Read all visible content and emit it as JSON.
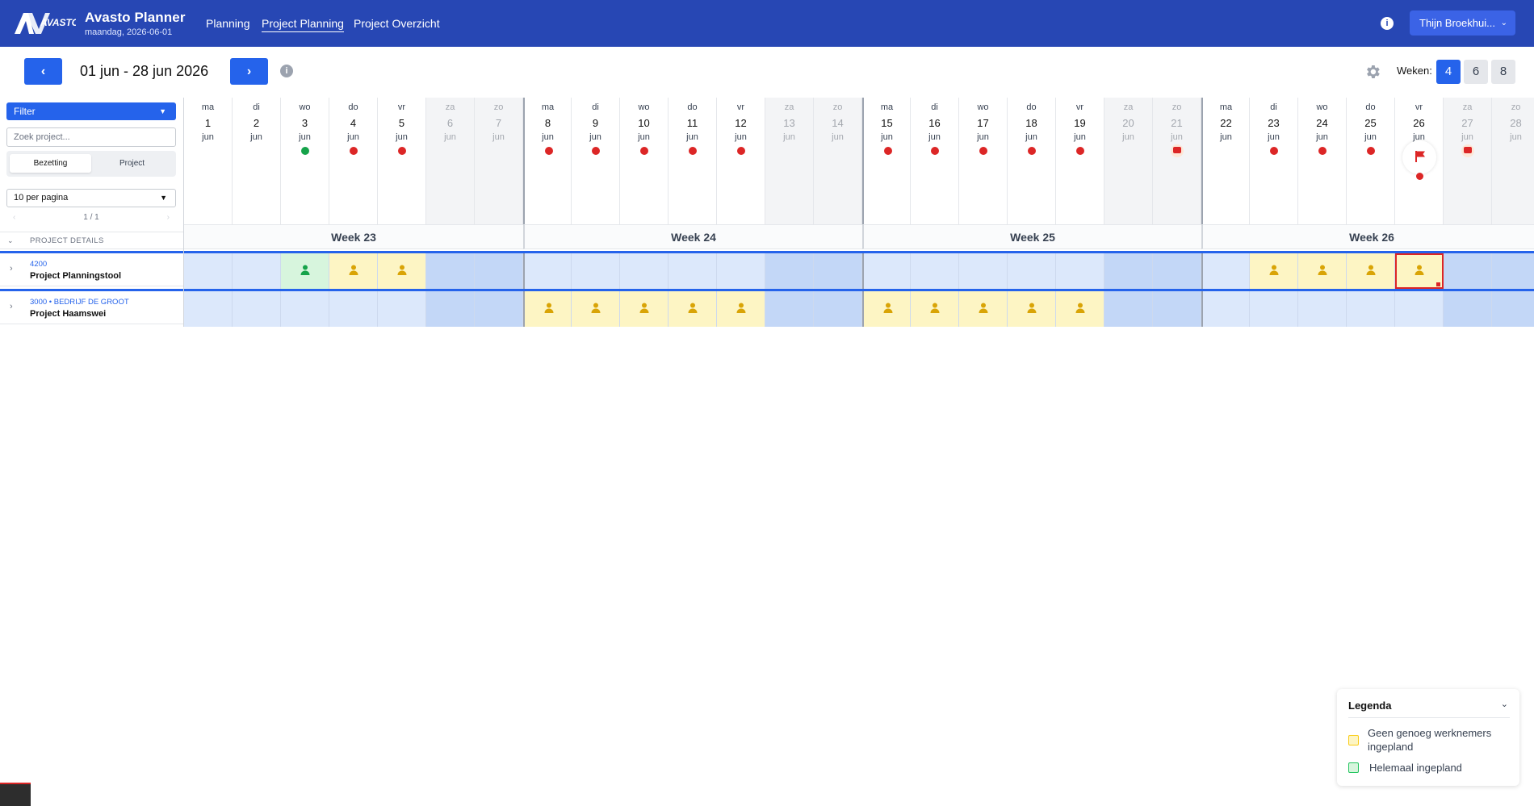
{
  "app": {
    "title": "Avasto Planner",
    "date": "maandag, 2026-06-01",
    "logo_text": "AVASTO"
  },
  "nav": {
    "items": [
      "Planning",
      "Project Planning",
      "Project Overzicht"
    ],
    "active": "Project Planning"
  },
  "user": {
    "name": "Thijn Broekhui..."
  },
  "toolbar": {
    "prev": "‹",
    "next": "›",
    "range": "01 jun - 28 jun 2026",
    "weeks_label": "Weken:",
    "week_options": [
      "4",
      "6",
      "8"
    ],
    "week_selected": "4"
  },
  "sidebar": {
    "filter_label": "Filter",
    "search_placeholder": "Zoek project...",
    "segments": [
      "Bezetting",
      "Project"
    ],
    "segment_selected": "Bezetting",
    "per_page": "10 per pagina",
    "pager": "1 / 1",
    "pager_prev": "‹",
    "pager_next": "›",
    "details_header": "PROJECT DETAILS"
  },
  "days": [
    {
      "dn": "ma",
      "d": "1",
      "m": "jun",
      "mark": ""
    },
    {
      "dn": "di",
      "d": "2",
      "m": "jun",
      "mark": ""
    },
    {
      "dn": "wo",
      "d": "3",
      "m": "jun",
      "mark": "green"
    },
    {
      "dn": "do",
      "d": "4",
      "m": "jun",
      "mark": "red"
    },
    {
      "dn": "vr",
      "d": "5",
      "m": "jun",
      "mark": "red"
    },
    {
      "dn": "za",
      "d": "6",
      "m": "jun",
      "mark": ""
    },
    {
      "dn": "zo",
      "d": "7",
      "m": "jun",
      "mark": ""
    },
    {
      "dn": "ma",
      "d": "8",
      "m": "jun",
      "mark": "red"
    },
    {
      "dn": "di",
      "d": "9",
      "m": "jun",
      "mark": "red"
    },
    {
      "dn": "wo",
      "d": "10",
      "m": "jun",
      "mark": "red"
    },
    {
      "dn": "do",
      "d": "11",
      "m": "jun",
      "mark": "red"
    },
    {
      "dn": "vr",
      "d": "12",
      "m": "jun",
      "mark": "red"
    },
    {
      "dn": "za",
      "d": "13",
      "m": "jun",
      "mark": ""
    },
    {
      "dn": "zo",
      "d": "14",
      "m": "jun",
      "mark": ""
    },
    {
      "dn": "ma",
      "d": "15",
      "m": "jun",
      "mark": "red"
    },
    {
      "dn": "di",
      "d": "16",
      "m": "jun",
      "mark": "red"
    },
    {
      "dn": "wo",
      "d": "17",
      "m": "jun",
      "mark": "red"
    },
    {
      "dn": "do",
      "d": "18",
      "m": "jun",
      "mark": "red"
    },
    {
      "dn": "vr",
      "d": "19",
      "m": "jun",
      "mark": "red"
    },
    {
      "dn": "za",
      "d": "20",
      "m": "jun",
      "mark": ""
    },
    {
      "dn": "zo",
      "d": "21",
      "m": "jun",
      "mark": "bag"
    },
    {
      "dn": "ma",
      "d": "22",
      "m": "jun",
      "mark": ""
    },
    {
      "dn": "di",
      "d": "23",
      "m": "jun",
      "mark": "red"
    },
    {
      "dn": "wo",
      "d": "24",
      "m": "jun",
      "mark": "red"
    },
    {
      "dn": "do",
      "d": "25",
      "m": "jun",
      "mark": "red"
    },
    {
      "dn": "vr",
      "d": "26",
      "m": "jun",
      "mark": "flag"
    },
    {
      "dn": "za",
      "d": "27",
      "m": "jun",
      "mark": "bag"
    },
    {
      "dn": "zo",
      "d": "28",
      "m": "jun",
      "mark": ""
    }
  ],
  "weeks": [
    "Week 23",
    "Week 24",
    "Week 25",
    "Week 26"
  ],
  "projects": [
    {
      "code": "4200",
      "name": "Project Planningstool",
      "cells": [
        "",
        "",
        "green",
        "yellow",
        "yellow",
        "",
        "",
        "",
        "",
        "",
        "",
        "",
        "",
        "",
        "",
        "",
        "",
        "",
        "",
        "",
        "",
        "",
        "yellow",
        "yellow",
        "yellow",
        "yellow",
        "",
        ""
      ],
      "selected_day": 25
    },
    {
      "code": "3000 • BEDRIJF DE GROOT",
      "name": "Project Haamswei",
      "cells": [
        "",
        "",
        "",
        "",
        "",
        "",
        "",
        "yellow",
        "yellow",
        "yellow",
        "yellow",
        "yellow",
        "",
        "",
        "yellow",
        "yellow",
        "yellow",
        "yellow",
        "yellow",
        "",
        "",
        "",
        "",
        "",
        "",
        "",
        "",
        ""
      ],
      "selected_day": -1
    }
  ],
  "legend": {
    "title": "Legenda",
    "items": [
      {
        "label": "Geen genoeg werknemers ingepland",
        "color": "#facc15"
      },
      {
        "label": "Helemaal ingepland",
        "color": "#22c55e"
      }
    ]
  },
  "colors": {
    "brand": "#2747b4",
    "primary": "#2563eb",
    "warning": "#dc2626",
    "ok": "#16a34a",
    "cell": "#dce8fb",
    "cell_weekend": "#c3d7f7",
    "cell_partial": "#fdf5c4",
    "cell_full": "#d7f5dd"
  }
}
